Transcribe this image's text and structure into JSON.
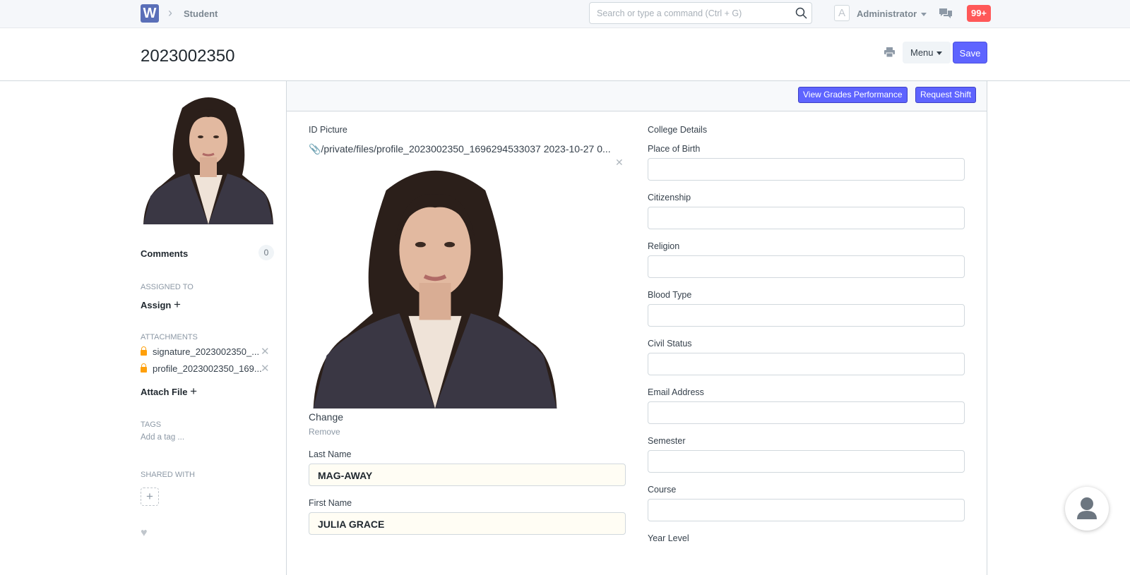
{
  "nav": {
    "logo": "W",
    "breadcrumb": "Student",
    "search_placeholder": "Search or type a command (Ctrl + G)",
    "avatar_letter": "A",
    "user": "Administrator",
    "notifications": "99+"
  },
  "header": {
    "title": "2023002350",
    "menu": "Menu",
    "save": "Save"
  },
  "sidebar": {
    "comments_label": "Comments",
    "comments_count": "0",
    "assigned_to": "Assigned To",
    "assign": "Assign",
    "attachments_label": "Attachments",
    "attachments": [
      {
        "name": "signature_2023002350_...",
        "locked": false
      },
      {
        "name": "profile_2023002350_169...",
        "locked": true
      }
    ],
    "attach_file": "Attach File",
    "tags_label": "Tags",
    "add_tag": "Add a tag ...",
    "shared_with": "Shared With"
  },
  "toolbar": {
    "view_grades": "View Grades Performance",
    "request_shift": "Request Shift"
  },
  "left": {
    "id_picture_label": "ID Picture",
    "file_path": "/private/files/profile_2023002350_1696294533037 2023-10-27 0...",
    "change": "Change",
    "remove": "Remove",
    "last_name_label": "Last Name",
    "last_name": "MAG-AWAY",
    "first_name_label": "First Name",
    "first_name": "JULIA GRACE"
  },
  "right": {
    "section": "College Details",
    "fields": [
      {
        "label": "Place of Birth",
        "value": ""
      },
      {
        "label": "Citizenship",
        "value": ""
      },
      {
        "label": "Religion",
        "value": ""
      },
      {
        "label": "Blood Type",
        "value": ""
      },
      {
        "label": "Civil Status",
        "value": ""
      },
      {
        "label": "Email Address",
        "value": ""
      },
      {
        "label": "Semester",
        "value": ""
      },
      {
        "label": "Course",
        "value": ""
      }
    ],
    "year_level_label": "Year Level"
  },
  "colors": {
    "primary": "#5e64ff",
    "notification": "#ff5858",
    "lock": "#ffa00a"
  }
}
